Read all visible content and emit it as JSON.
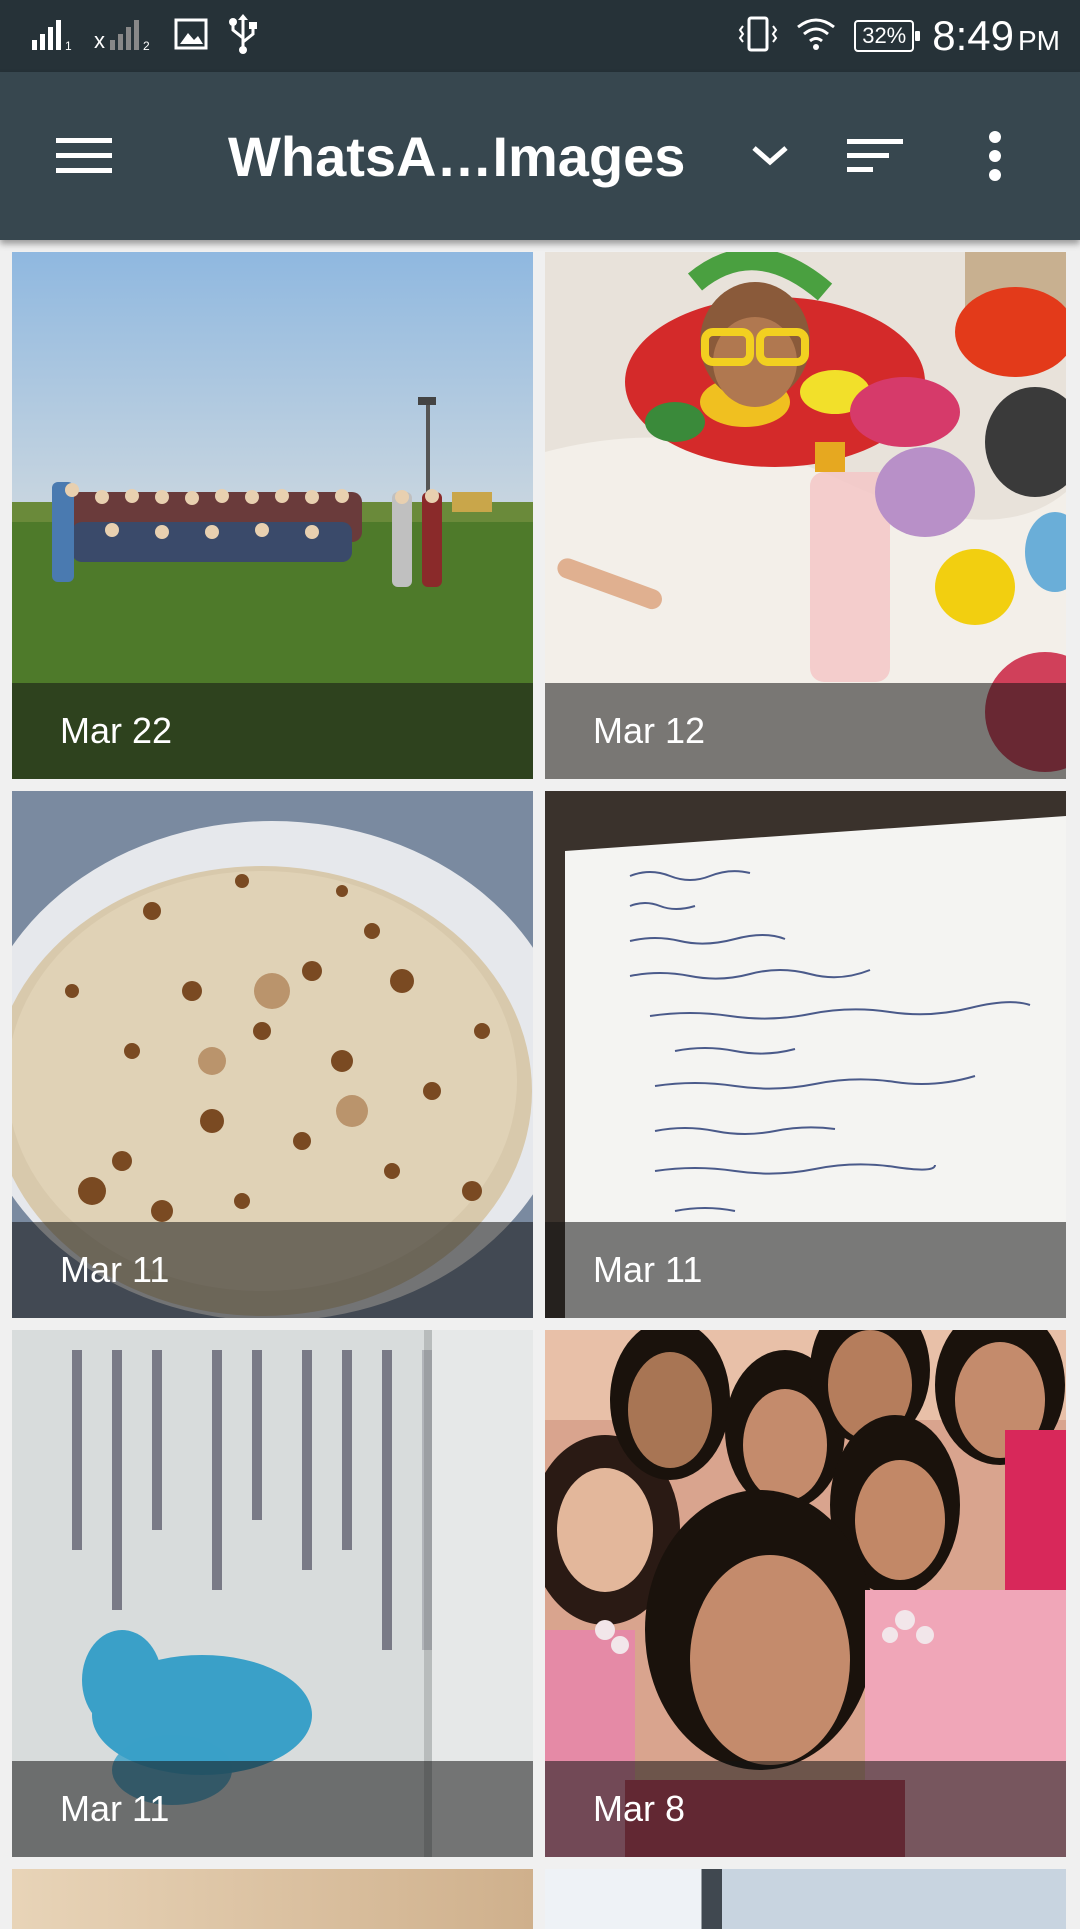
{
  "status_bar": {
    "battery": "32%",
    "time": "8:49",
    "ampm": "PM",
    "icons": [
      "signal-icon",
      "signal-x-icon",
      "image-notification-icon",
      "usb-icon",
      "vibrate-icon",
      "wifi-icon",
      "battery-icon"
    ]
  },
  "app_bar": {
    "title": "WhatsA…Images",
    "icons": [
      "menu-icon",
      "chevron-down-icon",
      "sort-icon",
      "more-vert-icon"
    ]
  },
  "photos": [
    {
      "date": "Mar 22",
      "subject": "group-photo-field"
    },
    {
      "date": "Mar 12",
      "subject": "baby-with-toys"
    },
    {
      "date": "Mar 11",
      "subject": "roti"
    },
    {
      "date": "Mar 11",
      "subject": "handwritten-notes"
    },
    {
      "date": "Mar 11",
      "subject": "passport-page"
    },
    {
      "date": "Mar 8",
      "subject": "group-selfie"
    }
  ],
  "colors": {
    "status_bar_bg": "#263238",
    "app_bar_bg": "#37474f",
    "page_bg": "#f0f0f0"
  }
}
